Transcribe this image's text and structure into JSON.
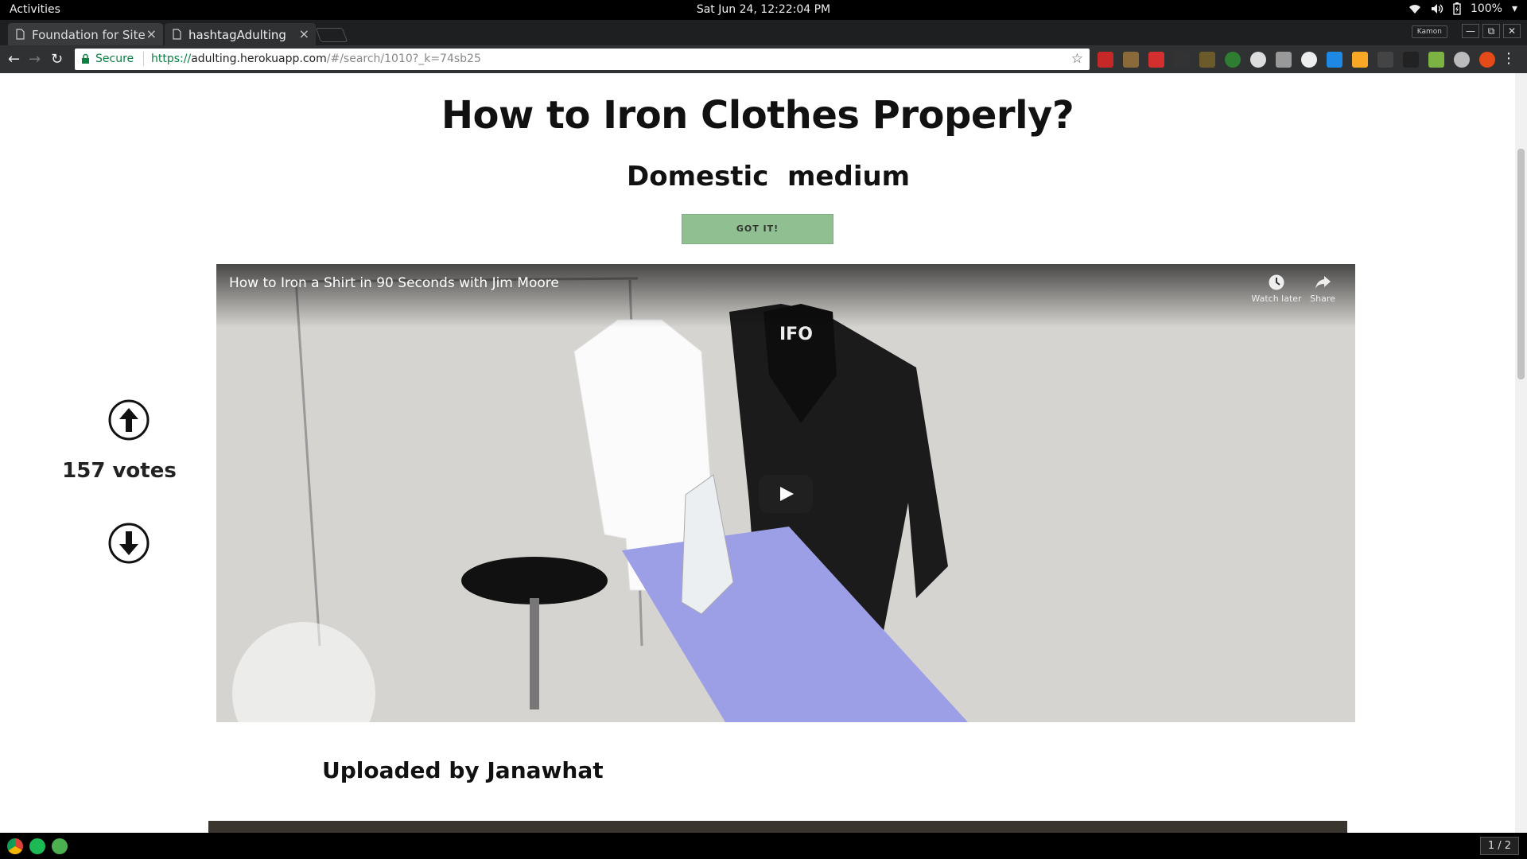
{
  "topbar": {
    "activities": "Activities",
    "clock": "Sat Jun 24, 12:22:04 PM",
    "battery": "100%"
  },
  "tabs": [
    {
      "title": "Foundation for Site",
      "active": false
    },
    {
      "title": "hashtagAdulting",
      "active": true
    }
  ],
  "browser": {
    "profile": "Kamon",
    "secure_label": "Secure",
    "url_scheme": "https://",
    "url_host": "adulting.herokuapp.com",
    "url_path": "/#/search/1010?_k=74sb25"
  },
  "page": {
    "title": "How to Iron Clothes Properly?",
    "category": "Domestic",
    "difficulty": "medium",
    "got_it_label": "GOT IT!",
    "votes_label": "157 votes",
    "uploaded_by": "Uploaded by Janawhat"
  },
  "video": {
    "title": "How to Iron a Shirt in 90 Seconds with Jim Moore",
    "watch_later": "Watch later",
    "share": "Share"
  },
  "dock": {
    "pager": "1 / 2"
  },
  "colors": {
    "got_it_bg": "#90c091",
    "secure_green": "#0b8043"
  }
}
